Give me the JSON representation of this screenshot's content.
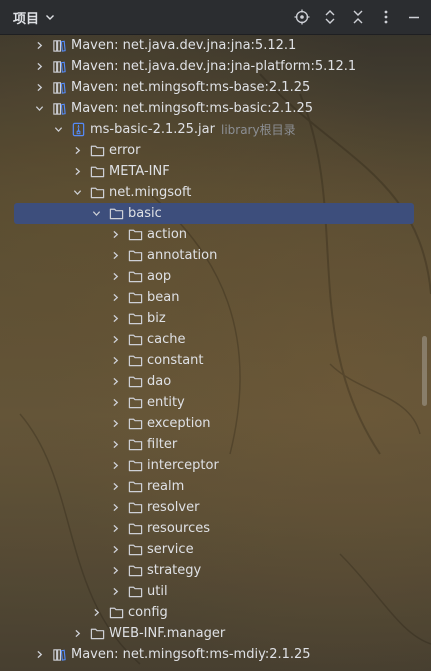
{
  "header": {
    "title": "项目",
    "tools": [
      {
        "name": "locate-icon"
      },
      {
        "name": "expand-all-icon"
      },
      {
        "name": "collapse-all-icon"
      },
      {
        "name": "more-options-icon"
      },
      {
        "name": "hide-panel-icon"
      }
    ]
  },
  "tree": {
    "rows": [
      {
        "indent": 0,
        "expanded": false,
        "type": "library",
        "label": "Maven: net.java.dev.jna:jna:5.12.1"
      },
      {
        "indent": 0,
        "expanded": false,
        "type": "library",
        "label": "Maven: net.java.dev.jna:jna-platform:5.12.1"
      },
      {
        "indent": 0,
        "expanded": false,
        "type": "library",
        "label": "Maven: net.mingsoft:ms-base:2.1.25"
      },
      {
        "indent": 0,
        "expanded": true,
        "type": "library",
        "label": "Maven: net.mingsoft:ms-basic:2.1.25"
      },
      {
        "indent": 1,
        "expanded": true,
        "type": "jar",
        "label": "ms-basic-2.1.25.jar",
        "hint": "library根目录"
      },
      {
        "indent": 2,
        "expanded": false,
        "type": "folder",
        "label": "error"
      },
      {
        "indent": 2,
        "expanded": false,
        "type": "folder",
        "label": "META-INF"
      },
      {
        "indent": 2,
        "expanded": true,
        "type": "folder",
        "label": "net.mingsoft"
      },
      {
        "indent": 3,
        "expanded": true,
        "type": "folder",
        "label": "basic",
        "selected": true
      },
      {
        "indent": 4,
        "expanded": false,
        "type": "folder",
        "label": "action"
      },
      {
        "indent": 4,
        "expanded": false,
        "type": "folder",
        "label": "annotation"
      },
      {
        "indent": 4,
        "expanded": false,
        "type": "folder",
        "label": "aop"
      },
      {
        "indent": 4,
        "expanded": false,
        "type": "folder",
        "label": "bean"
      },
      {
        "indent": 4,
        "expanded": false,
        "type": "folder",
        "label": "biz"
      },
      {
        "indent": 4,
        "expanded": false,
        "type": "folder",
        "label": "cache"
      },
      {
        "indent": 4,
        "expanded": false,
        "type": "folder",
        "label": "constant"
      },
      {
        "indent": 4,
        "expanded": false,
        "type": "folder",
        "label": "dao"
      },
      {
        "indent": 4,
        "expanded": false,
        "type": "folder",
        "label": "entity"
      },
      {
        "indent": 4,
        "expanded": false,
        "type": "folder",
        "label": "exception"
      },
      {
        "indent": 4,
        "expanded": false,
        "type": "folder",
        "label": "filter"
      },
      {
        "indent": 4,
        "expanded": false,
        "type": "folder",
        "label": "interceptor"
      },
      {
        "indent": 4,
        "expanded": false,
        "type": "folder",
        "label": "realm"
      },
      {
        "indent": 4,
        "expanded": false,
        "type": "folder",
        "label": "resolver"
      },
      {
        "indent": 4,
        "expanded": false,
        "type": "folder",
        "label": "resources"
      },
      {
        "indent": 4,
        "expanded": false,
        "type": "folder",
        "label": "service"
      },
      {
        "indent": 4,
        "expanded": false,
        "type": "folder",
        "label": "strategy"
      },
      {
        "indent": 4,
        "expanded": false,
        "type": "folder",
        "label": "util"
      },
      {
        "indent": 3,
        "expanded": false,
        "type": "folder",
        "label": "config"
      },
      {
        "indent": 2,
        "expanded": false,
        "type": "folder",
        "label": "WEB-INF.manager"
      },
      {
        "indent": 0,
        "expanded": false,
        "type": "library",
        "label": "Maven: net.mingsoft:ms-mdiy:2.1.25"
      }
    ]
  },
  "colors": {
    "background": "#2b2d30",
    "selection": "#3d4e7c",
    "text": "#dfe1e5",
    "hint": "#8c8f94",
    "library_icon": "#548af7",
    "folder_icon": "#ced0d6"
  }
}
